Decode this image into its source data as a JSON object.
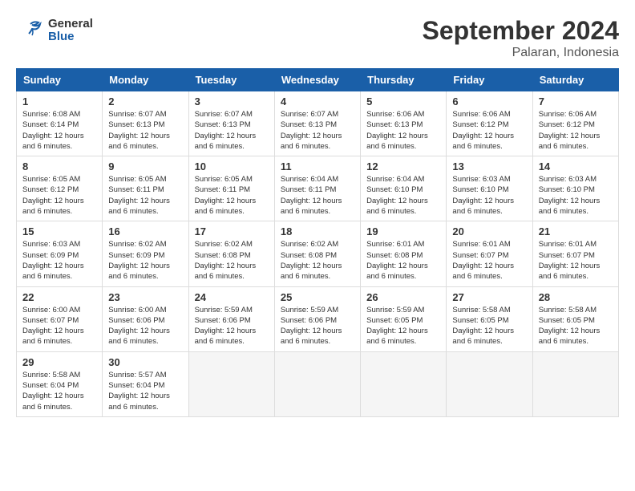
{
  "logo": {
    "line1": "General",
    "line2": "Blue"
  },
  "header": {
    "month": "September 2024",
    "location": "Palaran, Indonesia"
  },
  "weekdays": [
    "Sunday",
    "Monday",
    "Tuesday",
    "Wednesday",
    "Thursday",
    "Friday",
    "Saturday"
  ],
  "weeks": [
    [
      {
        "day": "1",
        "sunrise": "6:08 AM",
        "sunset": "6:14 PM",
        "daylight": "12 hours and 6 minutes."
      },
      {
        "day": "2",
        "sunrise": "6:07 AM",
        "sunset": "6:13 PM",
        "daylight": "12 hours and 6 minutes."
      },
      {
        "day": "3",
        "sunrise": "6:07 AM",
        "sunset": "6:13 PM",
        "daylight": "12 hours and 6 minutes."
      },
      {
        "day": "4",
        "sunrise": "6:07 AM",
        "sunset": "6:13 PM",
        "daylight": "12 hours and 6 minutes."
      },
      {
        "day": "5",
        "sunrise": "6:06 AM",
        "sunset": "6:13 PM",
        "daylight": "12 hours and 6 minutes."
      },
      {
        "day": "6",
        "sunrise": "6:06 AM",
        "sunset": "6:12 PM",
        "daylight": "12 hours and 6 minutes."
      },
      {
        "day": "7",
        "sunrise": "6:06 AM",
        "sunset": "6:12 PM",
        "daylight": "12 hours and 6 minutes."
      }
    ],
    [
      {
        "day": "8",
        "sunrise": "6:05 AM",
        "sunset": "6:12 PM",
        "daylight": "12 hours and 6 minutes."
      },
      {
        "day": "9",
        "sunrise": "6:05 AM",
        "sunset": "6:11 PM",
        "daylight": "12 hours and 6 minutes."
      },
      {
        "day": "10",
        "sunrise": "6:05 AM",
        "sunset": "6:11 PM",
        "daylight": "12 hours and 6 minutes."
      },
      {
        "day": "11",
        "sunrise": "6:04 AM",
        "sunset": "6:11 PM",
        "daylight": "12 hours and 6 minutes."
      },
      {
        "day": "12",
        "sunrise": "6:04 AM",
        "sunset": "6:10 PM",
        "daylight": "12 hours and 6 minutes."
      },
      {
        "day": "13",
        "sunrise": "6:03 AM",
        "sunset": "6:10 PM",
        "daylight": "12 hours and 6 minutes."
      },
      {
        "day": "14",
        "sunrise": "6:03 AM",
        "sunset": "6:10 PM",
        "daylight": "12 hours and 6 minutes."
      }
    ],
    [
      {
        "day": "15",
        "sunrise": "6:03 AM",
        "sunset": "6:09 PM",
        "daylight": "12 hours and 6 minutes."
      },
      {
        "day": "16",
        "sunrise": "6:02 AM",
        "sunset": "6:09 PM",
        "daylight": "12 hours and 6 minutes."
      },
      {
        "day": "17",
        "sunrise": "6:02 AM",
        "sunset": "6:08 PM",
        "daylight": "12 hours and 6 minutes."
      },
      {
        "day": "18",
        "sunrise": "6:02 AM",
        "sunset": "6:08 PM",
        "daylight": "12 hours and 6 minutes."
      },
      {
        "day": "19",
        "sunrise": "6:01 AM",
        "sunset": "6:08 PM",
        "daylight": "12 hours and 6 minutes."
      },
      {
        "day": "20",
        "sunrise": "6:01 AM",
        "sunset": "6:07 PM",
        "daylight": "12 hours and 6 minutes."
      },
      {
        "day": "21",
        "sunrise": "6:01 AM",
        "sunset": "6:07 PM",
        "daylight": "12 hours and 6 minutes."
      }
    ],
    [
      {
        "day": "22",
        "sunrise": "6:00 AM",
        "sunset": "6:07 PM",
        "daylight": "12 hours and 6 minutes."
      },
      {
        "day": "23",
        "sunrise": "6:00 AM",
        "sunset": "6:06 PM",
        "daylight": "12 hours and 6 minutes."
      },
      {
        "day": "24",
        "sunrise": "5:59 AM",
        "sunset": "6:06 PM",
        "daylight": "12 hours and 6 minutes."
      },
      {
        "day": "25",
        "sunrise": "5:59 AM",
        "sunset": "6:06 PM",
        "daylight": "12 hours and 6 minutes."
      },
      {
        "day": "26",
        "sunrise": "5:59 AM",
        "sunset": "6:05 PM",
        "daylight": "12 hours and 6 minutes."
      },
      {
        "day": "27",
        "sunrise": "5:58 AM",
        "sunset": "6:05 PM",
        "daylight": "12 hours and 6 minutes."
      },
      {
        "day": "28",
        "sunrise": "5:58 AM",
        "sunset": "6:05 PM",
        "daylight": "12 hours and 6 minutes."
      }
    ],
    [
      {
        "day": "29",
        "sunrise": "5:58 AM",
        "sunset": "6:04 PM",
        "daylight": "12 hours and 6 minutes."
      },
      {
        "day": "30",
        "sunrise": "5:57 AM",
        "sunset": "6:04 PM",
        "daylight": "12 hours and 6 minutes."
      },
      null,
      null,
      null,
      null,
      null
    ]
  ],
  "labels": {
    "sunrise": "Sunrise:",
    "sunset": "Sunset:",
    "daylight": "Daylight:"
  }
}
